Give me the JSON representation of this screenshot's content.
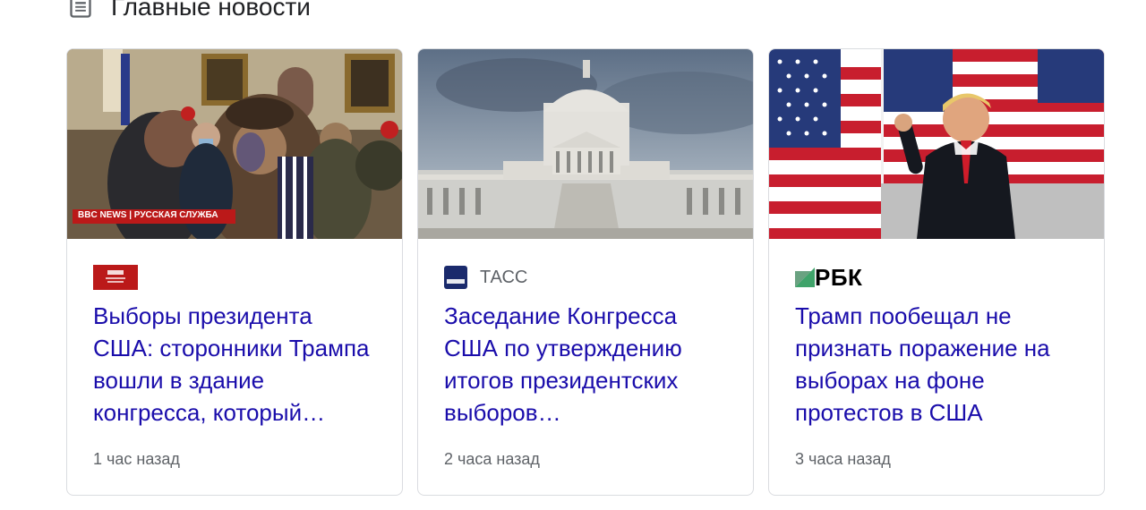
{
  "section": {
    "title": "Главные новости",
    "icon": "newspaper-icon"
  },
  "cards": [
    {
      "source_name": "",
      "source_logo": "bbc-russian-logo",
      "image_overlay_text": "BBC NEWS | РУССКАЯ СЛУЖБА",
      "headline": "Выборы президента США: сторонники Трампа вошли в здание конгресса, который…",
      "time": "1 час назад"
    },
    {
      "source_name": "ТАСС",
      "source_logo": "tass-logo",
      "headline": "Заседание Конгресса США по утверждению итогов президентских выборов…",
      "time": "2 часа назад"
    },
    {
      "source_name": "РБК",
      "source_logo": "rbc-logo",
      "headline": "Трамп пообещал не признать поражение на выборах на фоне протестов в США",
      "time": "3 часа назад"
    }
  ],
  "colors": {
    "link": "#1a0dab",
    "meta": "#5f6368",
    "border": "#dadce0",
    "bbc_red": "#bb1919",
    "tass_blue": "#1a2a6c",
    "rbc_green": "#3fa36a"
  }
}
